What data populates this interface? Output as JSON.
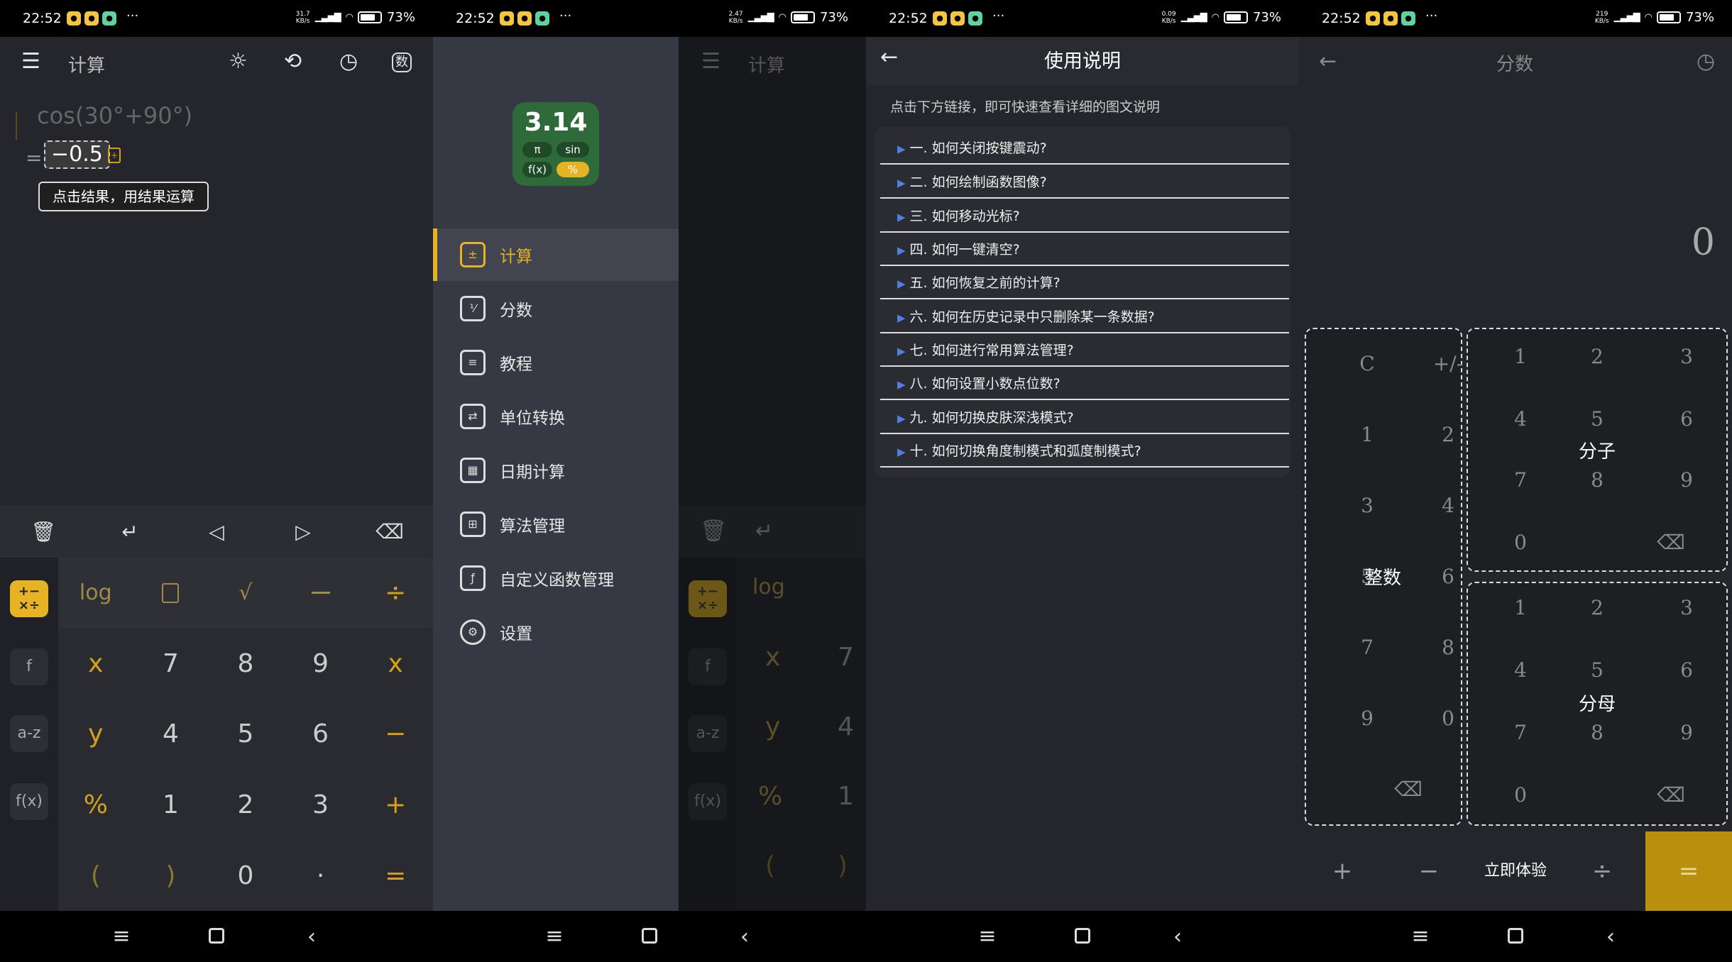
{
  "status_bars": [
    {
      "time": "22:52",
      "speed": "31.7\nKB/s",
      "battery": "73%"
    },
    {
      "time": "22:52",
      "speed": "2.47\nKB/s",
      "battery": "73%"
    },
    {
      "time": "22:52",
      "speed": "0.09\nKB/s",
      "battery": "73%"
    },
    {
      "time": "22:52",
      "speed": "219\nKB/s",
      "battery": "73%"
    }
  ],
  "calc": {
    "title": "计算",
    "expression": "cos(30°+90°)",
    "equals": "=",
    "result": "−0.5",
    "tooltip": "点击结果，用结果运算",
    "side_keys": [
      "f",
      "a-z",
      "f(x)"
    ],
    "keys": [
      [
        "log",
        "",
        "√",
        "⅟",
        "÷"
      ],
      [
        "x",
        "7",
        "8",
        "9",
        "x"
      ],
      [
        "y",
        "4",
        "5",
        "6",
        "−"
      ],
      [
        "%",
        "1",
        "2",
        "3",
        "+"
      ],
      [
        "(",
        ")",
        "0",
        "·",
        "="
      ]
    ]
  },
  "drawer": {
    "bg_title": "计算",
    "logo_value": "3.14",
    "logo_pills": [
      "π",
      "sin",
      "f(x)",
      "%"
    ],
    "items": [
      {
        "label": "计算",
        "icon": "calculator-icon"
      },
      {
        "label": "分数",
        "icon": "fraction-icon"
      },
      {
        "label": "教程",
        "icon": "book-icon"
      },
      {
        "label": "单位转换",
        "icon": "convert-icon"
      },
      {
        "label": "日期计算",
        "icon": "calendar-icon"
      },
      {
        "label": "算法管理",
        "icon": "apps-icon"
      },
      {
        "label": "自定义函数管理",
        "icon": "function-icon"
      },
      {
        "label": "设置",
        "icon": "gear-icon"
      }
    ],
    "bg_side_keys": [
      "f",
      "a-z",
      "f(x)"
    ],
    "bg_keys": [
      "log",
      "x",
      "7",
      "y",
      "4",
      "%",
      "1",
      "(",
      ")"
    ]
  },
  "help": {
    "title": "使用说明",
    "subtitle": "点击下方链接，即可快速查看详细的图文说明",
    "questions": [
      "一. 如何关闭按键震动?",
      "二. 如何绘制函数图像?",
      "三. 如何移动光标?",
      "四. 如何一键清空?",
      "五. 如何恢复之前的计算?",
      "六. 如何在历史记录中只删除某一条数据?",
      "七. 如何进行常用算法管理?",
      "八. 如何设置小数点位数?",
      "九. 如何切换皮肤深浅模式?",
      "十. 如何切换角度制模式和弧度制模式?"
    ]
  },
  "fraction": {
    "title": "分数",
    "display": "0",
    "integer_label": "整数",
    "numerator_label": "分子",
    "denominator_label": "分母",
    "integer_keys": [
      "C",
      "+/-",
      "1",
      "2",
      "3",
      "4",
      "5",
      "6",
      "7",
      "8",
      "9",
      "0"
    ],
    "pad_keys": [
      "1",
      "2",
      "3",
      "4",
      "5",
      "6",
      "7",
      "8",
      "9",
      "0"
    ],
    "bottom": {
      "plus": "+",
      "minus": "−",
      "try": "立即体验",
      "divide": "÷",
      "equals": "="
    }
  }
}
